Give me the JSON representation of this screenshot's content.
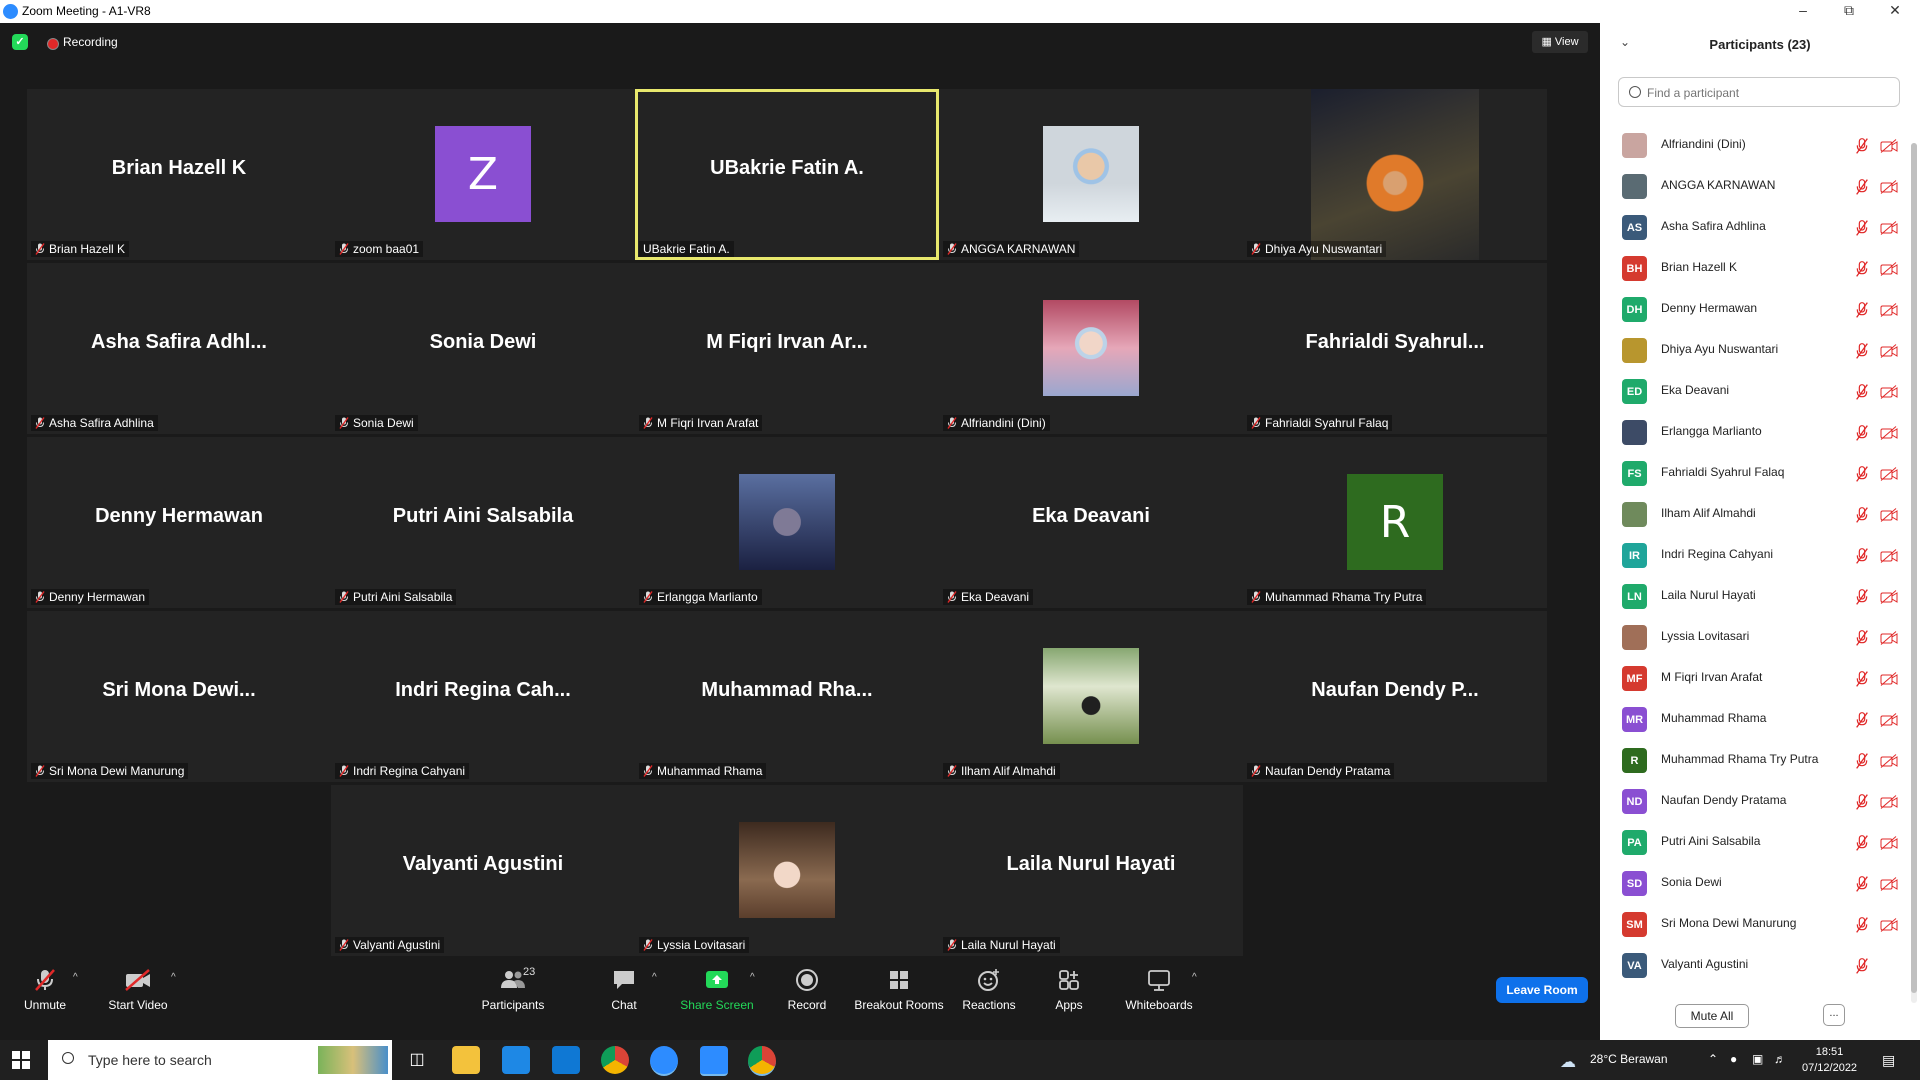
{
  "window": {
    "title": "Zoom Meeting - A1-VR8"
  },
  "topbar": {
    "recording_label": "Recording",
    "view_label": "View"
  },
  "tiles": [
    {
      "label": "Brian Hazell K",
      "big": "Brian Hazell K",
      "kind": "name",
      "muted": true
    },
    {
      "label": "zoom baa01",
      "kind": "letter",
      "letter": "Z",
      "color": "#8a4fd2",
      "muted": true
    },
    {
      "label": "UBakrie Fatin A.",
      "big": "UBakrie Fatin A.",
      "kind": "name",
      "muted": false,
      "active": true
    },
    {
      "label": "ANGGA KARNAWAN",
      "kind": "photo",
      "photo": "masked-man",
      "muted": true
    },
    {
      "label": "Dhiya Ayu Nuswantari",
      "kind": "photo",
      "photo": "night-street",
      "muted": true
    },
    {
      "label": "Asha Safira Adhlina",
      "big": "Asha Safira Adhl...",
      "kind": "name",
      "muted": true
    },
    {
      "label": "Sonia Dewi",
      "big": "Sonia Dewi",
      "kind": "name",
      "muted": true
    },
    {
      "label": "M Fiqri Irvan Arafat",
      "big": "M Fiqri Irvan Ar...",
      "kind": "name",
      "muted": true
    },
    {
      "label": "Alfriandini (Dini)",
      "kind": "photo",
      "photo": "masked-woman",
      "muted": true
    },
    {
      "label": "Fahrialdi Syahrul Falaq",
      "big": "Fahrialdi  Syahrul...",
      "kind": "name",
      "muted": true
    },
    {
      "label": "Denny Hermawan",
      "big": "Denny Hermawan",
      "kind": "name",
      "muted": true
    },
    {
      "label": "Putri Aini Salsabila",
      "big": "Putri Aini Salsabila",
      "kind": "name",
      "muted": true
    },
    {
      "label": "Erlangga Marlianto",
      "kind": "photo",
      "photo": "dark-selfie",
      "muted": true
    },
    {
      "label": "Eka Deavani",
      "big": "Eka Deavani",
      "kind": "name",
      "muted": true
    },
    {
      "label": "Muhammad Rhama Try Putra",
      "kind": "letter",
      "letter": "R",
      "color": "#2e6b1f",
      "muted": true
    },
    {
      "label": "Sri Mona Dewi Manurung",
      "big": "Sri Mona Dewi...",
      "kind": "name",
      "muted": true
    },
    {
      "label": "Indri Regina Cahyani",
      "big": "Indri Regina Cah...",
      "kind": "name",
      "muted": true
    },
    {
      "label": "Muhammad Rhama",
      "big": "Muhammad  Rha...",
      "kind": "name",
      "muted": true
    },
    {
      "label": "Ilham Alif Almahdi",
      "kind": "photo",
      "photo": "outdoor-man",
      "muted": true
    },
    {
      "label": "Naufan Dendy Pratama",
      "big": "Naufan Dendy P...",
      "kind": "name",
      "muted": true
    },
    {
      "label": "Valyanti Agustini",
      "big": "Valyanti Agustini",
      "kind": "name",
      "muted": true
    },
    {
      "label": "Lyssia Lovitasari",
      "kind": "photo",
      "photo": "child",
      "muted": true
    },
    {
      "label": "Laila Nurul Hayati",
      "big": "Laila Nurul Hayati",
      "kind": "name",
      "muted": true
    }
  ],
  "toolbar": {
    "unmute": "Unmute",
    "start_video": "Start Video",
    "participants": "Participants",
    "participants_count": "23",
    "chat": "Chat",
    "share_screen": "Share Screen",
    "record": "Record",
    "breakout_rooms": "Breakout Rooms",
    "reactions": "Reactions",
    "apps": "Apps",
    "whiteboards": "Whiteboards",
    "leave_room": "Leave Room"
  },
  "panel": {
    "title": "Participants (23)",
    "search_placeholder": "Find a participant",
    "mute_all": "Mute All",
    "more": "...",
    "participants": [
      {
        "name": "Alfriandini (Dini)",
        "avatar": "photo",
        "color": "#c9a5a0"
      },
      {
        "name": "ANGGA KARNAWAN",
        "avatar": "photo",
        "color": "#5a6b73"
      },
      {
        "name": "Asha Safira Adhlina",
        "initials": "AS",
        "color": "#3b5a7a"
      },
      {
        "name": "Brian Hazell K",
        "initials": "BH",
        "color": "#d53a2f"
      },
      {
        "name": "Denny Hermawan",
        "initials": "DH",
        "color": "#1faa6b"
      },
      {
        "name": "Dhiya Ayu Nuswantari",
        "avatar": "photo",
        "color": "#b8962e"
      },
      {
        "name": "Eka Deavani",
        "initials": "ED",
        "color": "#1faa6b"
      },
      {
        "name": "Erlangga Marlianto",
        "avatar": "photo",
        "color": "#3d4b66"
      },
      {
        "name": "Fahrialdi Syahrul Falaq",
        "initials": "FS",
        "color": "#1faa6b"
      },
      {
        "name": "Ilham Alif Almahdi",
        "avatar": "photo",
        "color": "#6f8a5c"
      },
      {
        "name": "Indri Regina Cahyani",
        "initials": "IR",
        "color": "#1fa59a"
      },
      {
        "name": "Laila Nurul Hayati",
        "initials": "LN",
        "color": "#1faa6b"
      },
      {
        "name": "Lyssia Lovitasari",
        "avatar": "photo",
        "color": "#a06f58"
      },
      {
        "name": "M Fiqri Irvan Arafat",
        "initials": "MF",
        "color": "#d53a2f"
      },
      {
        "name": "Muhammad Rhama",
        "initials": "MR",
        "color": "#8a4fd2"
      },
      {
        "name": "Muhammad Rhama Try Putra",
        "initials": "R",
        "color": "#2e6b1f"
      },
      {
        "name": "Naufan Dendy Pratama",
        "initials": "ND",
        "color": "#8a4fd2"
      },
      {
        "name": "Putri Aini Salsabila",
        "initials": "PA",
        "color": "#1faa6b"
      },
      {
        "name": "Sonia Dewi",
        "initials": "SD",
        "color": "#8a4fd2"
      },
      {
        "name": "Sri Mona Dewi Manurung",
        "initials": "SM",
        "color": "#d53a2f"
      },
      {
        "name": "Valyanti Agustini",
        "initials": "VA",
        "color": "#3b5a7a",
        "camera_hidden": true
      }
    ]
  },
  "taskbar": {
    "search_placeholder": "Type here to search",
    "weather": "28°C  Berawan",
    "time": "18:51",
    "date": "07/12/2022"
  },
  "colors": {
    "active_speaker": "#e8e86d",
    "leave": "#0e71eb",
    "share": "#23d959",
    "muted_red": "#e02828"
  }
}
